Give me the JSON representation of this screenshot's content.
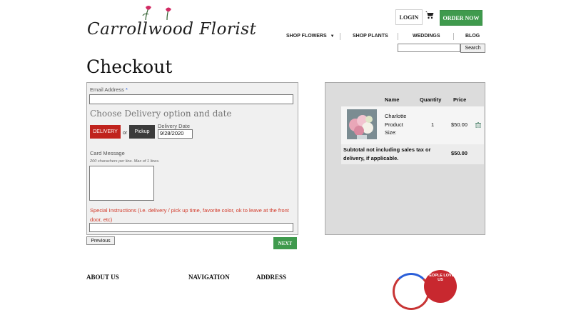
{
  "header": {
    "logo_text": "Carrollwood Florist",
    "login": "LOGIN",
    "order_now": "ORDER NOW",
    "nav": [
      {
        "label": "SHOP FLOWERS"
      },
      {
        "label": "SHOP PLANTS"
      },
      {
        "label": "WEDDINGS"
      },
      {
        "label": "BLOG"
      }
    ],
    "search_button": "Search",
    "search_value": ""
  },
  "page_title": "Checkout",
  "form": {
    "email_label": "Email Address",
    "email_required": "*",
    "email_value": "",
    "delivery_heading": "Choose Delivery option and date",
    "delivery_button": "DELIVERY",
    "or_text": "or",
    "pickup_button": "Pickup",
    "delivery_date_label": "Delivery Date",
    "delivery_date_value": "9/28/2020",
    "card_message_label": "Card Message",
    "card_message_hint": "200 charachers per line. Max of 1 lines.",
    "card_message_value": "",
    "special_instructions_label": "Special Instructions (i.e. delivery / pick up time, favorite color, ok to leave at the front door, etc)",
    "special_instructions_value": "",
    "previous_button": "Previous",
    "next_button": "NEXT"
  },
  "cart": {
    "headers": {
      "name": "Name",
      "quantity": "Quantity",
      "price": "Price"
    },
    "items": [
      {
        "name_line1": "Charlotte",
        "name_line2": "Product",
        "name_line3": "Size:",
        "quantity": "1",
        "price": "$50.00"
      }
    ],
    "subtotal_label": "Subtotal not including sales tax or delivery, if applicable.",
    "subtotal_value": "$50.00"
  },
  "footer": {
    "about": "ABOUT US",
    "navigation": "NAVIGATION",
    "address": "ADDRESS",
    "badge_text": "PEOPLE LOVE US"
  },
  "colors": {
    "green": "#3f9a4d",
    "delivery_red": "#c0231d",
    "pickup_dark": "#3b3b3b",
    "instruction_red": "#d23a2a"
  }
}
